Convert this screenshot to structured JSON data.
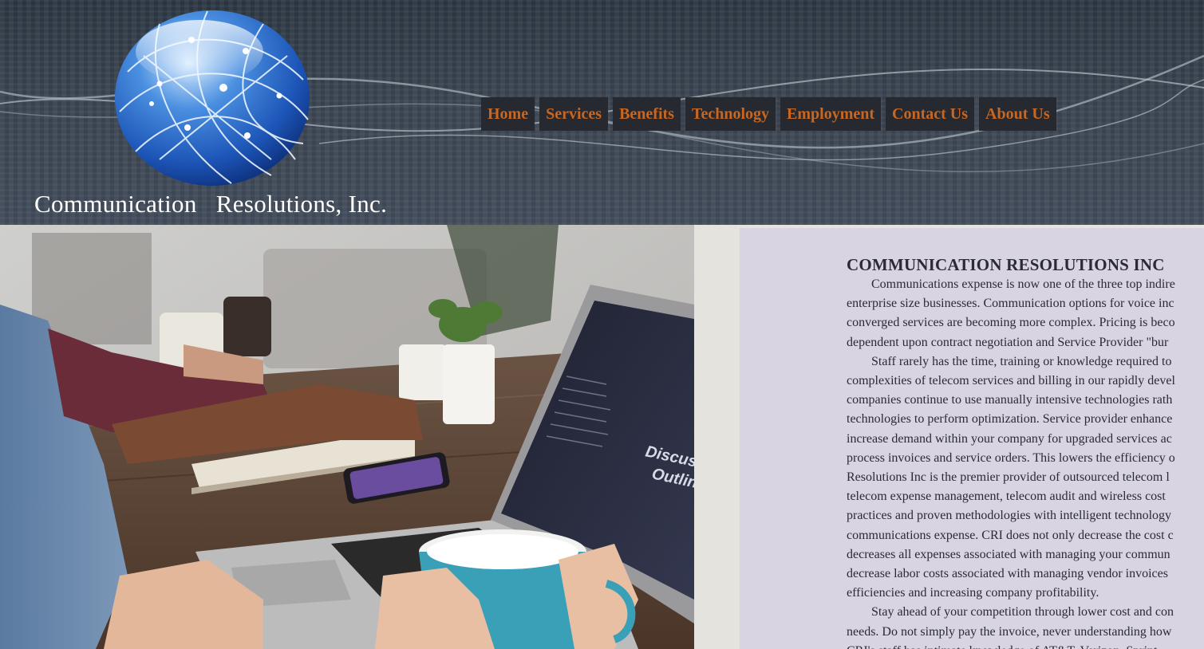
{
  "header": {
    "company_name": "Communication   Resolutions, Inc."
  },
  "nav": {
    "items": [
      {
        "label": "Home"
      },
      {
        "label": "Services"
      },
      {
        "label": "Benefits"
      },
      {
        "label": "Technology"
      },
      {
        "label": "Employment"
      },
      {
        "label": "Contact Us"
      },
      {
        "label": "About Us"
      }
    ]
  },
  "photo": {
    "screen_text": [
      "Discussion",
      "Outline"
    ]
  },
  "content": {
    "heading": "COMMUNICATION RESOLUTIONS INC",
    "lines": [
      "Communications expense is now one of the three top indire",
      "enterprise size businesses. Communication options for voice inc",
      "converged services are becoming more complex. Pricing is beco",
      "dependent upon contract negotiation and Service Provider \"bur",
      "Staff rarely has the time, training or knowledge required to",
      "complexities of telecom services and billing in our rapidly devel",
      "companies continue to use manually intensive technologies rath",
      "technologies to perform optimization. Service provider enhance",
      "increase demand within your company for upgraded services ac",
      "process invoices and service orders. This lowers the efficiency o",
      "Resolutions Inc is the premier provider of outsourced telecom l",
      "telecom expense management, telecom audit and wireless cost",
      "practices and proven methodologies with intelligent technology",
      "communications expense. CRI does not only decrease the cost c",
      "decreases all expenses associated with managing your commun",
      "decrease labor costs associated with managing vendor invoices",
      "efficiencies and increasing company profitability.",
      "Stay ahead of your competition through lower cost and con",
      "needs. Do not simply pay the invoice, never understanding how",
      "CRI's staff has intimate knowledge of AT&T, Verizon, Sprint, "
    ]
  }
}
